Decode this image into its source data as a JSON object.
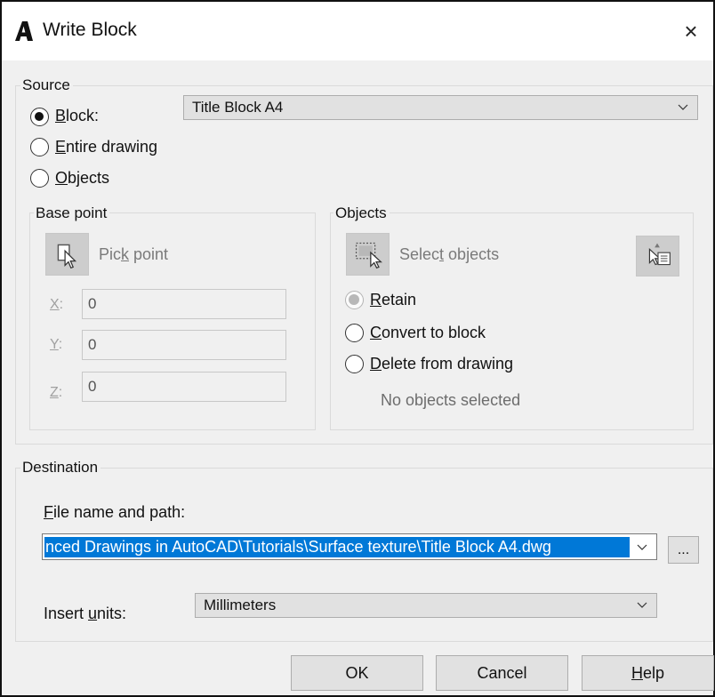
{
  "window": {
    "title": "Write Block",
    "close_glyph": "×",
    "logo_icon": "autocad-a-icon"
  },
  "source": {
    "legend": "Source",
    "options": [
      {
        "pre": "",
        "key": "B",
        "post": "lock:",
        "checked": true
      },
      {
        "pre": "",
        "key": "E",
        "post": "ntire drawing",
        "checked": false
      },
      {
        "pre": "",
        "key": "O",
        "post": "bjects",
        "checked": false
      }
    ],
    "block_select_value": "Title Block A4"
  },
  "base_point": {
    "legend": "Base point",
    "pick_point": {
      "pre": "Pic",
      "key": "k",
      "post": " point",
      "icon": "pick-point-icon"
    },
    "coords": [
      {
        "key": "X",
        "post": ":",
        "value": "0"
      },
      {
        "key": "Y",
        "post": ":",
        "value": "0"
      },
      {
        "key": "Z",
        "post": ":",
        "value": "0"
      }
    ]
  },
  "objects": {
    "legend": "Objects",
    "select_objects": {
      "pre": "Selec",
      "key": "t",
      "post": " objects",
      "icon": "select-objects-icon"
    },
    "quick_select_icon": "quick-select-icon",
    "options": [
      {
        "pre": "",
        "key": "R",
        "post": "etain",
        "checked": true
      },
      {
        "pre": "",
        "key": "C",
        "post": "onvert to block",
        "checked": false
      },
      {
        "pre": "",
        "key": "D",
        "post": "elete from drawing",
        "checked": false
      }
    ],
    "status": "No objects selected"
  },
  "destination": {
    "legend": "Destination",
    "file_label": {
      "pre": "",
      "key": "F",
      "post": "ile name and path:"
    },
    "file_path": "nced Drawings in AutoCAD\\Tutorials\\Surface texture\\Title Block A4.dwg",
    "browse_label": "...",
    "units_label": {
      "pre": "Insert ",
      "key": "u",
      "post": "nits:"
    },
    "units_value": "Millimeters"
  },
  "buttons": {
    "ok": "OK",
    "cancel": "Cancel",
    "help": {
      "pre": "",
      "key": "H",
      "post": "elp"
    }
  },
  "colors": {
    "selection": "#0078d7",
    "dialog_bg": "#f0f0f0"
  }
}
